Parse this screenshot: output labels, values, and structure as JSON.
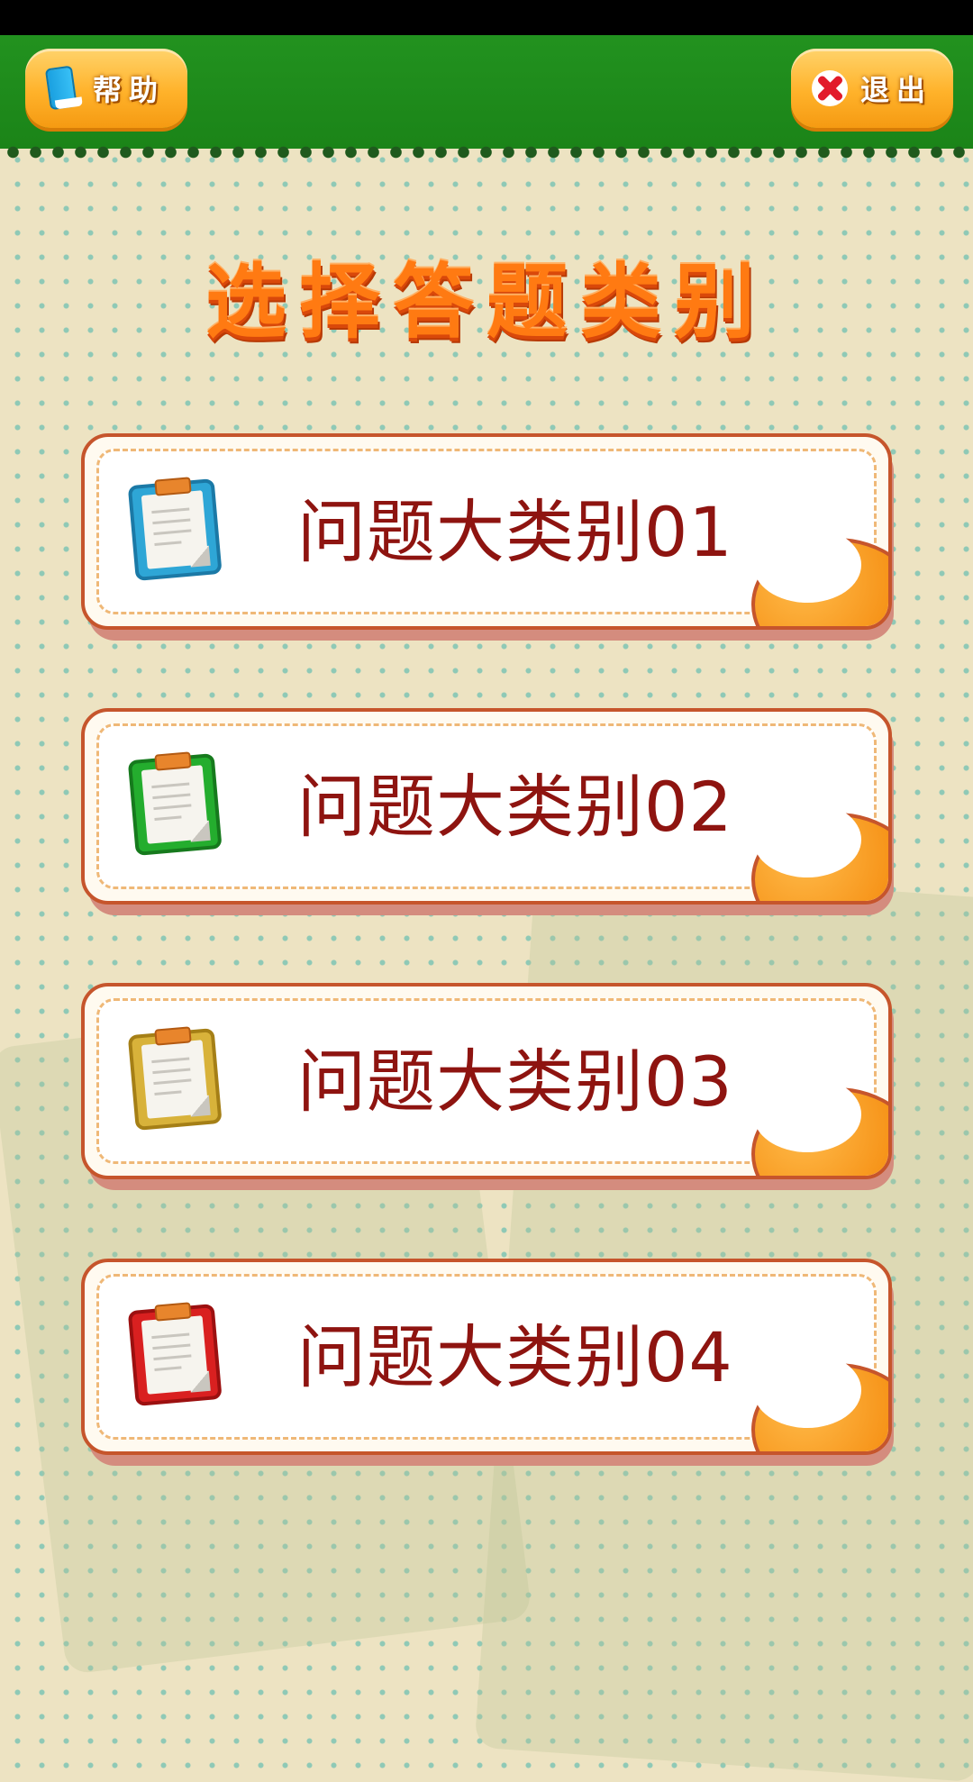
{
  "header": {
    "help_label": "帮助",
    "exit_label": "退出",
    "help_icon": "book-icon",
    "exit_icon": "close-icon"
  },
  "title": "选择答题类别",
  "categories": [
    {
      "label": "问题大类别01",
      "icon": "clipboard-icon",
      "color": "#2ea6d6",
      "color_dark": "#1b79a6"
    },
    {
      "label": "问题大类别02",
      "icon": "clipboard-icon",
      "color": "#24ad2e",
      "color_dark": "#167a1d"
    },
    {
      "label": "问题大类别03",
      "icon": "clipboard-icon",
      "color": "#d8b23a",
      "color_dark": "#a57f16"
    },
    {
      "label": "问题大类别04",
      "icon": "clipboard-icon",
      "color": "#d92020",
      "color_dark": "#9c1010"
    }
  ],
  "colors": {
    "header_green": "#1f8c1c",
    "background": "#ede3c2",
    "title_orange": "#ff7a12",
    "label_red": "#8e1410",
    "button_orange": "#ffb22a"
  }
}
